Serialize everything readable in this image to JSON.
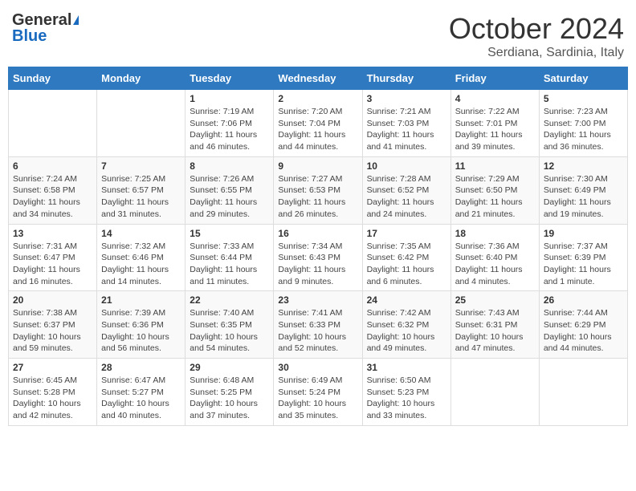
{
  "header": {
    "logo_general": "General",
    "logo_blue": "Blue",
    "month_title": "October 2024",
    "location": "Serdiana, Sardinia, Italy"
  },
  "days_of_week": [
    "Sunday",
    "Monday",
    "Tuesday",
    "Wednesday",
    "Thursday",
    "Friday",
    "Saturday"
  ],
  "weeks": [
    [
      {
        "day": "",
        "content": ""
      },
      {
        "day": "",
        "content": ""
      },
      {
        "day": "1",
        "content": "Sunrise: 7:19 AM\nSunset: 7:06 PM\nDaylight: 11 hours and 46 minutes."
      },
      {
        "day": "2",
        "content": "Sunrise: 7:20 AM\nSunset: 7:04 PM\nDaylight: 11 hours and 44 minutes."
      },
      {
        "day": "3",
        "content": "Sunrise: 7:21 AM\nSunset: 7:03 PM\nDaylight: 11 hours and 41 minutes."
      },
      {
        "day": "4",
        "content": "Sunrise: 7:22 AM\nSunset: 7:01 PM\nDaylight: 11 hours and 39 minutes."
      },
      {
        "day": "5",
        "content": "Sunrise: 7:23 AM\nSunset: 7:00 PM\nDaylight: 11 hours and 36 minutes."
      }
    ],
    [
      {
        "day": "6",
        "content": "Sunrise: 7:24 AM\nSunset: 6:58 PM\nDaylight: 11 hours and 34 minutes."
      },
      {
        "day": "7",
        "content": "Sunrise: 7:25 AM\nSunset: 6:57 PM\nDaylight: 11 hours and 31 minutes."
      },
      {
        "day": "8",
        "content": "Sunrise: 7:26 AM\nSunset: 6:55 PM\nDaylight: 11 hours and 29 minutes."
      },
      {
        "day": "9",
        "content": "Sunrise: 7:27 AM\nSunset: 6:53 PM\nDaylight: 11 hours and 26 minutes."
      },
      {
        "day": "10",
        "content": "Sunrise: 7:28 AM\nSunset: 6:52 PM\nDaylight: 11 hours and 24 minutes."
      },
      {
        "day": "11",
        "content": "Sunrise: 7:29 AM\nSunset: 6:50 PM\nDaylight: 11 hours and 21 minutes."
      },
      {
        "day": "12",
        "content": "Sunrise: 7:30 AM\nSunset: 6:49 PM\nDaylight: 11 hours and 19 minutes."
      }
    ],
    [
      {
        "day": "13",
        "content": "Sunrise: 7:31 AM\nSunset: 6:47 PM\nDaylight: 11 hours and 16 minutes."
      },
      {
        "day": "14",
        "content": "Sunrise: 7:32 AM\nSunset: 6:46 PM\nDaylight: 11 hours and 14 minutes."
      },
      {
        "day": "15",
        "content": "Sunrise: 7:33 AM\nSunset: 6:44 PM\nDaylight: 11 hours and 11 minutes."
      },
      {
        "day": "16",
        "content": "Sunrise: 7:34 AM\nSunset: 6:43 PM\nDaylight: 11 hours and 9 minutes."
      },
      {
        "day": "17",
        "content": "Sunrise: 7:35 AM\nSunset: 6:42 PM\nDaylight: 11 hours and 6 minutes."
      },
      {
        "day": "18",
        "content": "Sunrise: 7:36 AM\nSunset: 6:40 PM\nDaylight: 11 hours and 4 minutes."
      },
      {
        "day": "19",
        "content": "Sunrise: 7:37 AM\nSunset: 6:39 PM\nDaylight: 11 hours and 1 minute."
      }
    ],
    [
      {
        "day": "20",
        "content": "Sunrise: 7:38 AM\nSunset: 6:37 PM\nDaylight: 10 hours and 59 minutes."
      },
      {
        "day": "21",
        "content": "Sunrise: 7:39 AM\nSunset: 6:36 PM\nDaylight: 10 hours and 56 minutes."
      },
      {
        "day": "22",
        "content": "Sunrise: 7:40 AM\nSunset: 6:35 PM\nDaylight: 10 hours and 54 minutes."
      },
      {
        "day": "23",
        "content": "Sunrise: 7:41 AM\nSunset: 6:33 PM\nDaylight: 10 hours and 52 minutes."
      },
      {
        "day": "24",
        "content": "Sunrise: 7:42 AM\nSunset: 6:32 PM\nDaylight: 10 hours and 49 minutes."
      },
      {
        "day": "25",
        "content": "Sunrise: 7:43 AM\nSunset: 6:31 PM\nDaylight: 10 hours and 47 minutes."
      },
      {
        "day": "26",
        "content": "Sunrise: 7:44 AM\nSunset: 6:29 PM\nDaylight: 10 hours and 44 minutes."
      }
    ],
    [
      {
        "day": "27",
        "content": "Sunrise: 6:45 AM\nSunset: 5:28 PM\nDaylight: 10 hours and 42 minutes."
      },
      {
        "day": "28",
        "content": "Sunrise: 6:47 AM\nSunset: 5:27 PM\nDaylight: 10 hours and 40 minutes."
      },
      {
        "day": "29",
        "content": "Sunrise: 6:48 AM\nSunset: 5:25 PM\nDaylight: 10 hours and 37 minutes."
      },
      {
        "day": "30",
        "content": "Sunrise: 6:49 AM\nSunset: 5:24 PM\nDaylight: 10 hours and 35 minutes."
      },
      {
        "day": "31",
        "content": "Sunrise: 6:50 AM\nSunset: 5:23 PM\nDaylight: 10 hours and 33 minutes."
      },
      {
        "day": "",
        "content": ""
      },
      {
        "day": "",
        "content": ""
      }
    ]
  ]
}
